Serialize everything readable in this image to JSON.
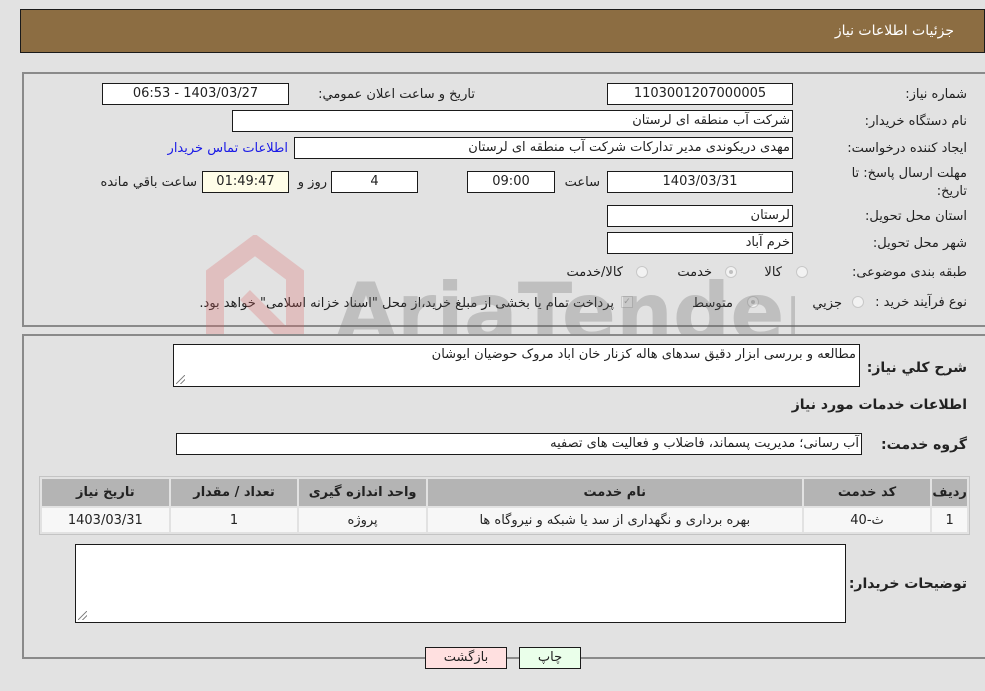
{
  "header": {
    "title": "جزئیات اطلاعات نیاز"
  },
  "form": {
    "need_number": {
      "label": "شماره نیاز:",
      "value": "1103001207000005"
    },
    "announce_datetime": {
      "label": "تاریخ و ساعت اعلان عمومي:",
      "value": "1403/03/27 - 06:53"
    },
    "buyer_org": {
      "label": "نام دستگاه خريدار:",
      "value": "شرکت آب منطقه ای لرستان"
    },
    "requester": {
      "label": "ایجاد کننده درخواست:",
      "value": "مهدی دریکوندی مدیر تدارکات شرکت آب منطقه ای لرستان"
    },
    "buyer_contact_link": "اطلاعات تماس خريدار",
    "deadline": {
      "label_line1": "مهلت ارسال پاسخ: تا",
      "label_line2": "تاریخ:",
      "date": "1403/03/31",
      "time_label": "ساعت",
      "time": "09:00",
      "days": "4",
      "days_label": "روز و",
      "remaining": "01:49:47",
      "remaining_label": "ساعت باقي مانده"
    },
    "province": {
      "label": "استان محل تحویل:",
      "value": "لرستان"
    },
    "city": {
      "label": "شهر محل تحویل:",
      "value": "خرم آباد"
    },
    "category": {
      "label": "طبقه بندی موضوعی:",
      "options": [
        "کالا",
        "خدمت",
        "کالا/خدمت"
      ],
      "selected": "خدمت"
    },
    "purchase_type": {
      "label": "نوع فرآیند خرید :",
      "options": [
        "جزيي",
        "متوسط"
      ],
      "selected": "متوسط",
      "treasury_checkbox_label": "پرداخت تمام يا بخشی از مبلغ خريد،از محل \"اسناد خزانه اسلامی\" خواهد بود.",
      "treasury_checked": true
    }
  },
  "details": {
    "description_label": "شرح كلي نياز:",
    "description": "مطالعه و بررسی ابزار دقیق سدهای هاله کزنار خان اباد مروک حوضیان ایوشان",
    "services_title": "اطلاعات خدمات مورد نياز",
    "service_group_label": "گروه خدمت:",
    "service_group": "آب رسانی؛ مدیریت پسماند، فاضلاب و فعالیت های تصفیه",
    "table": {
      "headers": [
        "رديف",
        "كد خدمت",
        "نام خدمت",
        "واحد اندازه گيری",
        "تعداد / مقدار",
        "تاريخ نياز"
      ],
      "rows": [
        [
          "1",
          "ث-40",
          "بهره برداری و نگهداری از سد یا شبکه و نیروگاه ها",
          "پروژه",
          "1",
          "1403/03/31"
        ]
      ]
    },
    "buyer_notes_label": "توضيحات خريدار:",
    "buyer_notes": ""
  },
  "buttons": {
    "print": "چاپ",
    "back": "بازگشت"
  },
  "watermark": "AriaTender.neT",
  "colors": {
    "header_bg": "#8c6d42",
    "print_bg": "#eaffea",
    "back_bg": "#ffe0e0",
    "link": "#1a1ae6"
  }
}
